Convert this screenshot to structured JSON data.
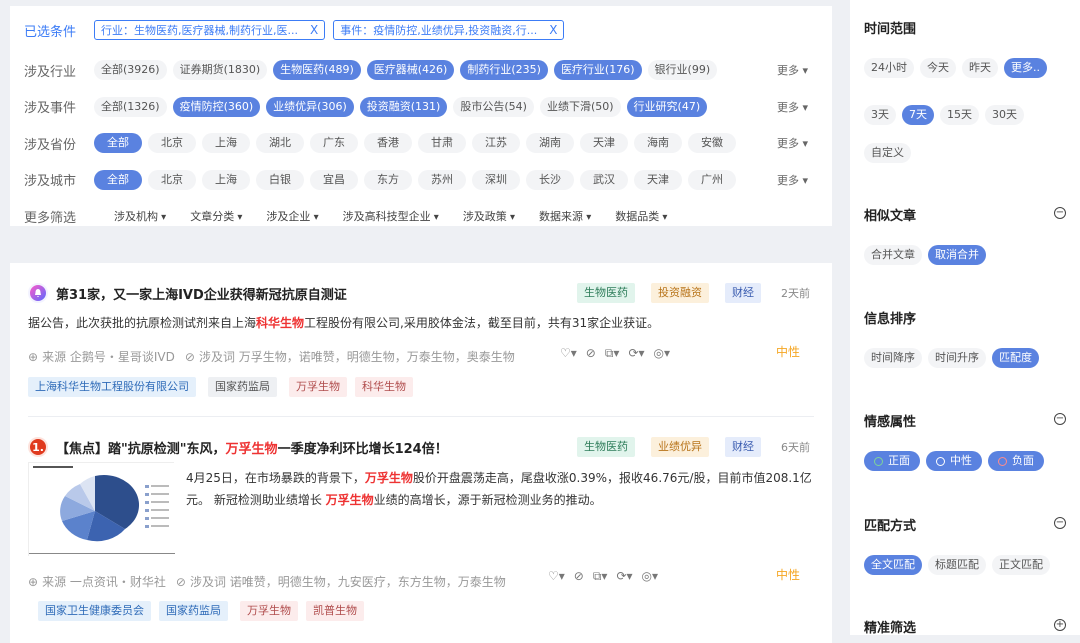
{
  "filters": {
    "selected_label": "已选条件",
    "selected_tags": [
      "行业：生物医药,医疗器械,制药行业,医...",
      "事件：疫情防控,业绩优异,投资融资,行..."
    ],
    "close": "X",
    "more": "更多",
    "rows": [
      {
        "label": "涉及行业",
        "items": [
          {
            "text": "全部(3926)",
            "sel": false
          },
          {
            "text": "证券期货(1830)",
            "sel": false
          },
          {
            "text": "生物医药(489)",
            "sel": true
          },
          {
            "text": "医疗器械(426)",
            "sel": true
          },
          {
            "text": "制药行业(235)",
            "sel": true
          },
          {
            "text": "医疗行业(176)",
            "sel": true
          },
          {
            "text": "银行业(99)",
            "sel": false
          }
        ]
      },
      {
        "label": "涉及事件",
        "items": [
          {
            "text": "全部(1326)",
            "sel": false
          },
          {
            "text": "疫情防控(360)",
            "sel": true
          },
          {
            "text": "业绩优异(306)",
            "sel": true
          },
          {
            "text": "投资融资(131)",
            "sel": true
          },
          {
            "text": "股市公告(54)",
            "sel": false
          },
          {
            "text": "业绩下滑(50)",
            "sel": false
          },
          {
            "text": "行业研究(47)",
            "sel": true
          }
        ]
      },
      {
        "label": "涉及省份",
        "items": [
          {
            "text": "全部",
            "sel": true
          },
          {
            "text": "北京",
            "sel": false
          },
          {
            "text": "上海",
            "sel": false
          },
          {
            "text": "湖北",
            "sel": false
          },
          {
            "text": "广东",
            "sel": false
          },
          {
            "text": "香港",
            "sel": false
          },
          {
            "text": "甘肃",
            "sel": false
          },
          {
            "text": "江苏",
            "sel": false
          },
          {
            "text": "湖南",
            "sel": false
          },
          {
            "text": "天津",
            "sel": false
          },
          {
            "text": "海南",
            "sel": false
          },
          {
            "text": "安徽",
            "sel": false
          }
        ]
      },
      {
        "label": "涉及城市",
        "items": [
          {
            "text": "全部",
            "sel": true
          },
          {
            "text": "北京",
            "sel": false
          },
          {
            "text": "上海",
            "sel": false
          },
          {
            "text": "白银",
            "sel": false
          },
          {
            "text": "宜昌",
            "sel": false
          },
          {
            "text": "东方",
            "sel": false
          },
          {
            "text": "苏州",
            "sel": false
          },
          {
            "text": "深圳",
            "sel": false
          },
          {
            "text": "长沙",
            "sel": false
          },
          {
            "text": "武汉",
            "sel": false
          },
          {
            "text": "天津",
            "sel": false
          },
          {
            "text": "广州",
            "sel": false
          }
        ]
      }
    ],
    "more_filters_label": "更多筛选",
    "dropdowns": [
      "涉及机构",
      "文章分类",
      "涉及企业",
      "涉及高科技型企业",
      "涉及政策",
      "数据来源",
      "数据品类"
    ]
  },
  "articles": [
    {
      "title": "第31家，又一家上海IVD企业获得新冠抗原自测证",
      "categories": [
        "生物医药",
        "投资融资",
        "财经"
      ],
      "time": "2天前",
      "body_pre": "据公告，此次获批的抗原检测试剂来自上海",
      "body_hl": "科华生物",
      "body_post": "工程股份有限公司,采用胶体金法，截至目前，共有31家企业获证。",
      "source": "来源 企鹅号・星哥谈IVD",
      "keywords": "涉及词 万孚生物，诺唯赞，明德生物，万泰生物，奥泰生物",
      "sentiment": "中性",
      "entities": [
        "上海科华生物工程股份有限公司",
        "国家药监局",
        "万孚生物",
        "科华生物"
      ]
    },
    {
      "title_pre": "【焦点】踏\"抗原检测\"东风，",
      "title_hl": "万孚生物",
      "title_post": "一季度净利环比增长124倍！",
      "badge": "1.",
      "categories": [
        "生物医药",
        "业绩优异",
        "财经"
      ],
      "time": "6天前",
      "body_a": "4月25日，在市场暴跌的背景下，",
      "body_hl1": "万孚生物",
      "body_b": "股价开盘震荡走高，尾盘收涨0.39%，报收46.76元/股，目前市值208.1亿元。 新冠检测助业绩增长 ",
      "body_hl2": "万孚生物",
      "body_c": "业绩的高增长，源于新冠检测业务的推动。",
      "source": "来源 一点资讯・财华社",
      "keywords": "涉及词 诺唯赞，明德生物，九安医疗，东方生物，万泰生物",
      "sentiment": "中性",
      "entities": [
        "国家卫生健康委员会",
        "国家药监局",
        "万孚生物",
        "凯普生物"
      ]
    }
  ],
  "sidebar": {
    "time_range": {
      "title": "时间范围",
      "options": [
        "24小时",
        "今天",
        "昨天",
        "更多..",
        "3天",
        "7天",
        "15天",
        "30天",
        "自定义"
      ],
      "selected": [
        "更多..",
        "7天"
      ]
    },
    "similar": {
      "title": "相似文章",
      "options": [
        "合并文章",
        "取消合并"
      ],
      "selected": [
        "取消合并"
      ]
    },
    "sort": {
      "title": "信息排序",
      "options": [
        "时间降序",
        "时间升序",
        "匹配度"
      ],
      "selected": [
        "匹配度"
      ]
    },
    "sentiment": {
      "title": "情感属性",
      "options": [
        "正面",
        "中性",
        "负面"
      ]
    },
    "match": {
      "title": "匹配方式",
      "options": [
        "全文匹配",
        "标题匹配",
        "正文匹配"
      ],
      "selected": [
        "全文匹配"
      ]
    },
    "precise": {
      "title": "精准筛选"
    }
  },
  "colors": {
    "accent": "#5a82e0",
    "link": "#3c7cf6",
    "highlight": "#e33333",
    "neutral": "#f5a623"
  }
}
